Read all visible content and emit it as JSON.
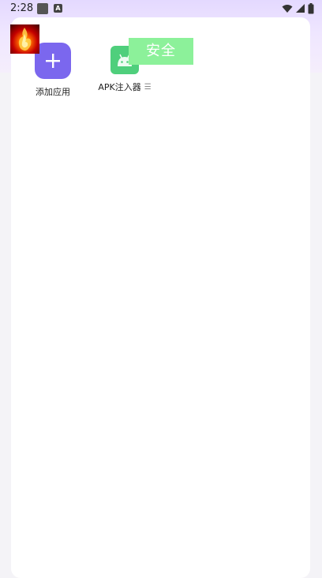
{
  "status_bar": {
    "time": "2:28",
    "icons": [
      "notification-square-icon",
      "a-notification-icon",
      "wifi-icon",
      "signal-icon",
      "battery-icon"
    ]
  },
  "apps": [
    {
      "label": "添加应用",
      "icon": "plus-icon",
      "color": "#7b67ee"
    },
    {
      "label": "APK注入器",
      "icon": "android-icon",
      "color": "#4fcf7c"
    }
  ],
  "overlay": {
    "badge_text": "安全",
    "badge_color": "#8cf19a",
    "avatar_icon": "fire-phoenix-avatar"
  },
  "colors": {
    "accent": "#7b67ee",
    "header_gradient": "#e4d9ff"
  }
}
